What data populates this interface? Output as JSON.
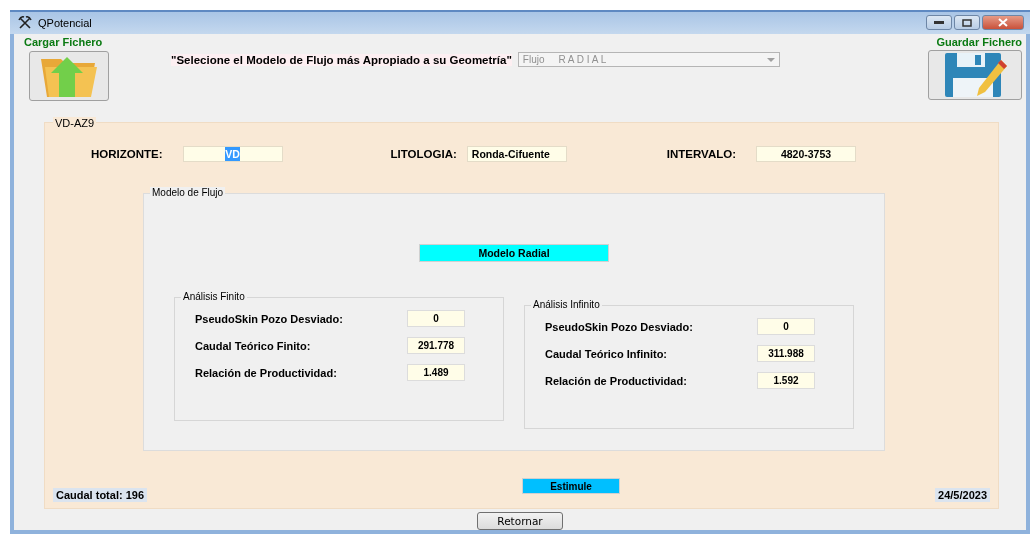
{
  "window": {
    "title": "QPotencial"
  },
  "load_button": {
    "label": "Cargar Fichero"
  },
  "prompt": "\"Selecione el Modelo de Flujo más Apropiado a su Geometría\"",
  "flow_select": {
    "value": "Flujo     R A D I A L",
    "disabled": true
  },
  "save_button": {
    "label": "Guardar Fichero"
  },
  "well_group": {
    "title": "VD-AZ9",
    "fields": [
      {
        "label": "HORIZONTE:",
        "value": "VD",
        "highlighted": true
      },
      {
        "label": "LITOLOGIA:",
        "value": "Ronda-Cifuente",
        "highlighted": false
      },
      {
        "label": "INTERVALO:",
        "value": "4820-3753",
        "highlighted": false
      }
    ],
    "model_group": {
      "title": "Modelo de Flujo",
      "model": "Modelo Radial",
      "analyses": [
        {
          "title": "Análisis Finito",
          "rows": [
            {
              "label": "PseudoSkin Pozo Desviado:",
              "value": "0"
            },
            {
              "label": "Caudal Teórico Finito:",
              "value": "291.778"
            },
            {
              "label": "Relación de Productividad:",
              "value": "1.489"
            }
          ]
        },
        {
          "title": "Análisis Infinito",
          "rows": [
            {
              "label": "PseudoSkin Pozo Desviado:",
              "value": "0"
            },
            {
              "label": "Caudal Teórico Infinito:",
              "value": "311.988"
            },
            {
              "label": "Relación de Productividad:",
              "value": "1.592"
            }
          ]
        }
      ]
    },
    "total": "Caudal total: 196",
    "status": "Estimule",
    "date": "24/5/2023"
  },
  "return_button": "Retornar"
}
